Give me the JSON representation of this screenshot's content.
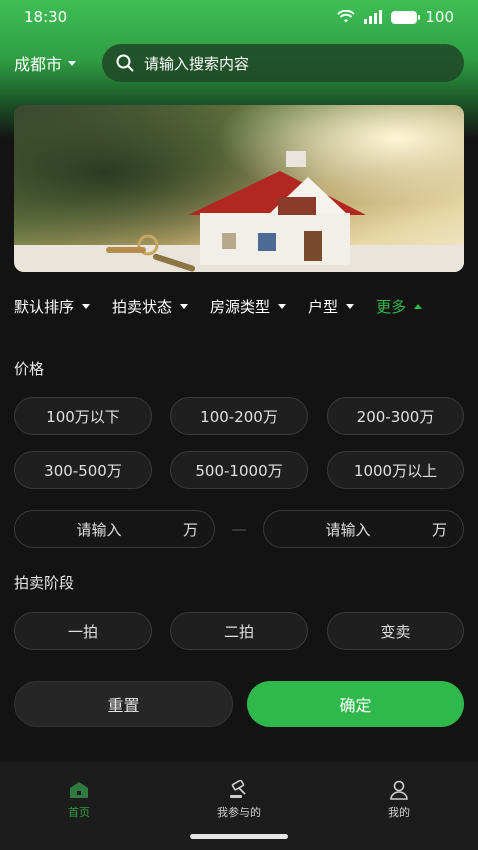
{
  "status_bar": {
    "time": "18:30",
    "battery": "100"
  },
  "header": {
    "city": "成都市",
    "search_placeholder": "请输入搜索内容"
  },
  "filters": [
    {
      "label": "默认排序",
      "icon": "chevron-down-icon"
    },
    {
      "label": "拍卖状态",
      "icon": "chevron-down-icon"
    },
    {
      "label": "房源类型",
      "icon": "chevron-down-icon"
    },
    {
      "label": "户型",
      "icon": "chevron-down-icon"
    },
    {
      "label": "更多",
      "icon": "chevron-up-icon",
      "active": true
    }
  ],
  "price": {
    "title": "价格",
    "options": [
      "100万以下",
      "100-200万",
      "200-300万",
      "300-500万",
      "500-1000万",
      "1000万以上"
    ],
    "min_placeholder": "请输入",
    "max_placeholder": "请输入",
    "unit": "万",
    "separator": "—"
  },
  "stage": {
    "title": "拍卖阶段",
    "options": [
      "一拍",
      "二拍",
      "变卖"
    ]
  },
  "actions": {
    "reset": "重置",
    "confirm": "确定"
  },
  "tabbar": [
    {
      "label": "首页",
      "icon": "home-icon",
      "active": true
    },
    {
      "label": "我参与的",
      "icon": "gavel-icon"
    },
    {
      "label": "我的",
      "icon": "user-icon"
    }
  ],
  "colors": {
    "accent": "#2fb84b",
    "background": "#131313",
    "chip": "#1f1f1f"
  }
}
